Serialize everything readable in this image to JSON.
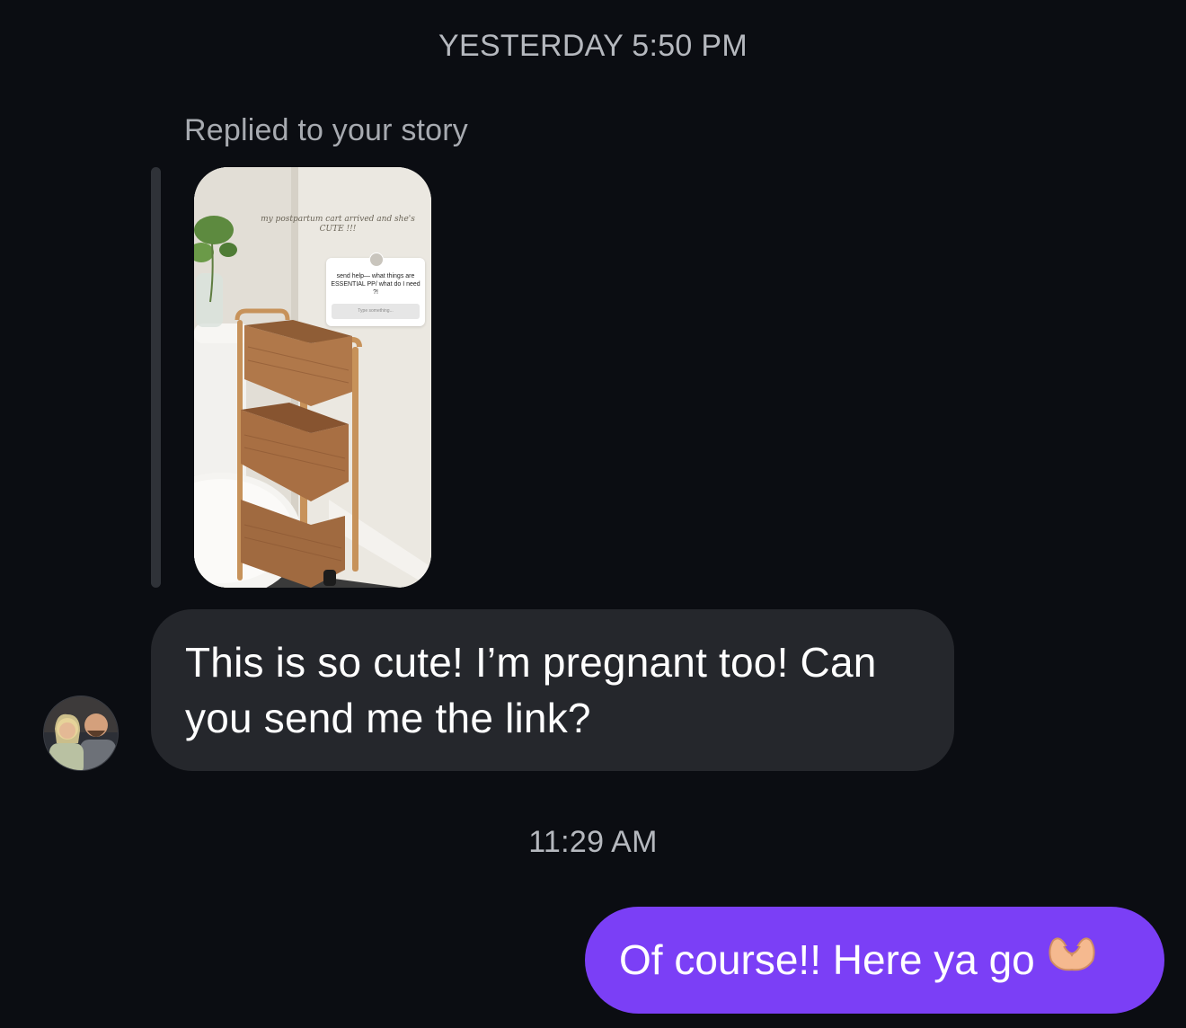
{
  "thread": {
    "timestamp_top": "YESTERDAY 5:50 PM",
    "timestamp_mid": "11:29 AM"
  },
  "incoming": {
    "reply_label": "Replied to your story",
    "story": {
      "overlay_text": "my postpartum cart arrived and she's CUTE !!!",
      "question_sticker_text": "send help— what things are ESSENTIAL PP/ what do I need ?!",
      "question_sticker_placeholder": "Type something..."
    },
    "message": "This is so cute! I’m pregnant too! Can you send me the link?"
  },
  "outgoing": {
    "message": "Of course!! Here ya go",
    "emoji": "heart-hands-icon"
  },
  "colors": {
    "background": "#0b0d12",
    "incoming_bubble": "#25272c",
    "outgoing_bubble": "#7b3ff6",
    "timestamp_text": "#b5b8be"
  }
}
